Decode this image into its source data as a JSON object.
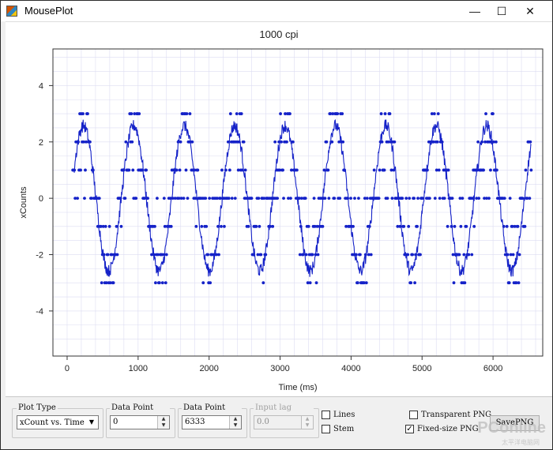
{
  "window": {
    "title": "MousePlot",
    "minimize": "—",
    "maximize": "☐",
    "close": "✕"
  },
  "colors": {
    "series": "#1522c8",
    "grid": "#dcdcf2",
    "axis": "#333333"
  },
  "chart_data": {
    "type": "scatter",
    "title": "1000 cpi",
    "xlabel": "Time (ms)",
    "ylabel": "xCounts",
    "xlim": [
      -200,
      6700
    ],
    "ylim": [
      -5.6,
      5.3
    ],
    "xticks": [
      0,
      1000,
      2000,
      3000,
      4000,
      5000,
      6000
    ],
    "yticks": [
      -4,
      -2,
      0,
      2,
      4
    ],
    "grid": true,
    "series": [
      {
        "style": "points",
        "note": "raw xCount samples, approx. sinusoid period ~710 ms, values -5..5"
      },
      {
        "style": "line",
        "note": "moving average, amplitude ~2.7"
      }
    ],
    "period_ms": 710,
    "phase_ms": 230,
    "x_start": 80,
    "x_end": 6540
  },
  "controls": {
    "plot_type": {
      "label": "Plot Type",
      "value": "xCount vs. Time"
    },
    "dp_start": {
      "label": "Data Point Start",
      "value": "0"
    },
    "dp_end": {
      "label": "Data Point End",
      "value": "6333"
    },
    "input_lag": {
      "label": "Input lag delay",
      "value": "0.0"
    },
    "lines": {
      "label": "Lines",
      "checked": false
    },
    "stem": {
      "label": "Stem",
      "checked": false
    },
    "transparent_png": {
      "label": "Transparent PNG",
      "checked": false
    },
    "fixed_png": {
      "label": "Fixed-size PNG",
      "checked": true
    },
    "save_png": "SavePNG"
  },
  "watermark": {
    "brand": "PConline",
    "sub": "太平洋电脑网"
  }
}
